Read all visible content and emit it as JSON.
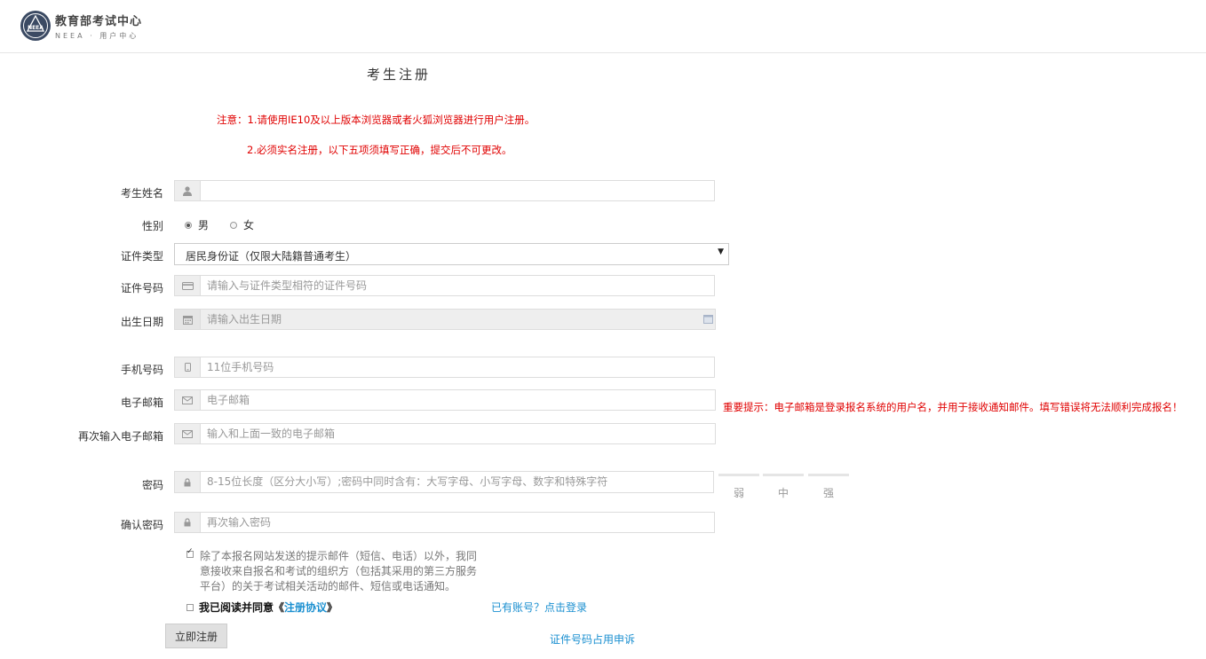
{
  "header": {
    "logo_title": "教育部考试中心",
    "logo_subtitle": "NEEA · 用户中心",
    "logo_mark_text": "NEEA"
  },
  "page_title": "考生注册",
  "notices": [
    "注意：1.请使用IE10及以上版本浏览器或者火狐浏览器进行用户注册。",
    "2.必须实名注册，以下五项须填写正确，提交后不可更改。"
  ],
  "form": {
    "name": {
      "label": "考生姓名",
      "value": "",
      "placeholder": "",
      "icon": "user-icon"
    },
    "gender": {
      "label": "性别",
      "options": [
        "男",
        "女"
      ],
      "selected": "男"
    },
    "id_type": {
      "label": "证件类型",
      "selected": "居民身份证（仅限大陆籍普通考生）"
    },
    "id_number": {
      "label": "证件号码",
      "value": "",
      "placeholder": "请输入与证件类型相符的证件号码",
      "icon": "id-card-icon"
    },
    "birth_date": {
      "label": "出生日期",
      "value": "",
      "placeholder": "请输入出生日期",
      "icon": "calendar-icon"
    },
    "mobile": {
      "label": "手机号码",
      "value": "",
      "placeholder": "11位手机号码",
      "icon": "mobile-icon"
    },
    "email": {
      "label": "电子邮箱",
      "value": "",
      "placeholder": "电子邮箱",
      "icon": "envelope-icon"
    },
    "email_confirm": {
      "label": "再次输入电子邮箱",
      "value": "",
      "placeholder": "输入和上面一致的电子邮箱",
      "icon": "envelope-icon"
    },
    "password": {
      "label": "密码",
      "value": "",
      "placeholder": "8-15位长度（区分大小写）;密码中同时含有：大写字母、小写字母、数字和特殊字符",
      "icon": "lock-icon"
    },
    "password_confirm": {
      "label": "确认密码",
      "value": "",
      "placeholder": "再次输入密码",
      "icon": "lock-icon"
    },
    "password_strength": [
      "弱",
      "中",
      "强"
    ]
  },
  "email_tip": "重要提示：电子邮箱是登录报名系统的用户名，并用于接收通知邮件。填写错误将无法顺利完成报名！",
  "consent": {
    "checked": true,
    "text": "除了本报名网站发送的提示邮件（短信、电话）以外，我同意接收来自报名和考试的组织方（包括其采用的第三方服务平台）的关于考试相关活动的邮件、短信或电话通知。"
  },
  "agreement": {
    "checked": false,
    "prefix": "我已阅读并同意《",
    "link": "注册协议",
    "suffix": "》"
  },
  "links": {
    "login": "已有账号？点击登录",
    "appeal": "证件号码占用申诉"
  },
  "submit_label": "立即注册",
  "colors": {
    "notice_red": "#e00000",
    "link_blue": "#1a8fd0"
  }
}
